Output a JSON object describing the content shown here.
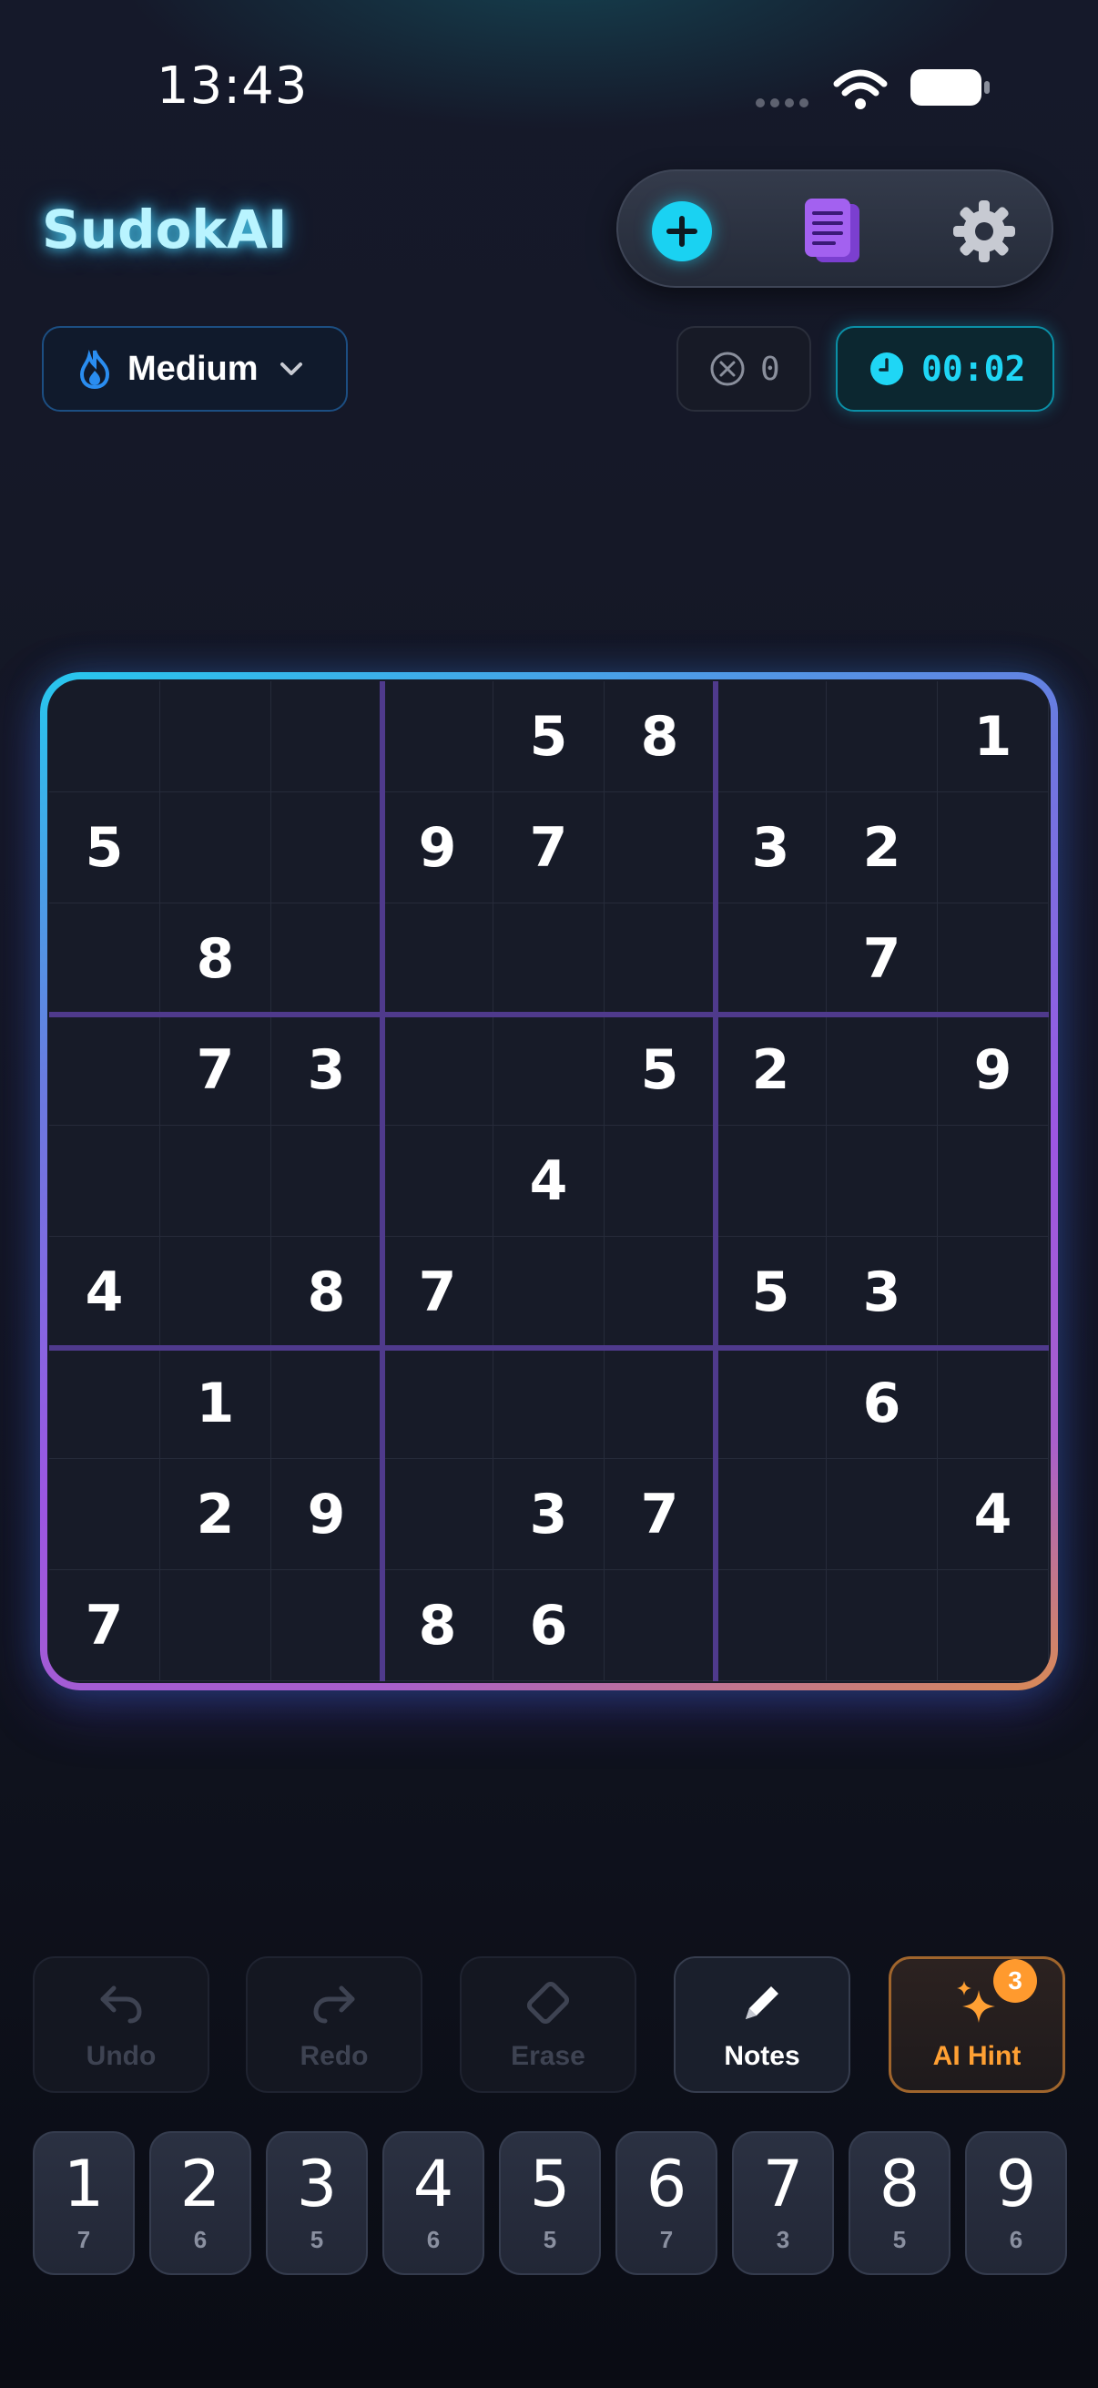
{
  "status_bar": {
    "time": "13:43"
  },
  "header": {
    "app_title": "SudokAI"
  },
  "toolbar": {
    "new_game_icon": "plus-icon",
    "notebook_icon": "notebook-icon",
    "settings_icon": "gear-icon"
  },
  "difficulty": {
    "label": "Medium",
    "icon": "flame-icon"
  },
  "stats": {
    "mistakes": "0",
    "timer": "00:02"
  },
  "board": {
    "rows": [
      [
        "",
        "",
        "",
        "",
        "5",
        "8",
        "",
        "",
        "1"
      ],
      [
        "5",
        "",
        "",
        "9",
        "7",
        "",
        "3",
        "2",
        ""
      ],
      [
        "",
        "8",
        "",
        "",
        "",
        "",
        "",
        "7",
        ""
      ],
      [
        "",
        "7",
        "3",
        "",
        "",
        "5",
        "2",
        "",
        "9"
      ],
      [
        "",
        "",
        "",
        "",
        "4",
        "",
        "",
        "",
        ""
      ],
      [
        "4",
        "",
        "8",
        "7",
        "",
        "",
        "5",
        "3",
        ""
      ],
      [
        "",
        "1",
        "",
        "",
        "",
        "",
        "",
        "6",
        ""
      ],
      [
        "",
        "2",
        "9",
        "",
        "3",
        "7",
        "",
        "",
        "4"
      ],
      [
        "7",
        "",
        "",
        "8",
        "6",
        "",
        "",
        "",
        ""
      ]
    ]
  },
  "actions": {
    "undo_label": "Undo",
    "redo_label": "Redo",
    "erase_label": "Erase",
    "notes_label": "Notes",
    "ai_hint_label": "AI Hint",
    "ai_hint_count": "3"
  },
  "number_pad": [
    {
      "digit": "1",
      "remaining": "7"
    },
    {
      "digit": "2",
      "remaining": "6"
    },
    {
      "digit": "3",
      "remaining": "5"
    },
    {
      "digit": "4",
      "remaining": "6"
    },
    {
      "digit": "5",
      "remaining": "5"
    },
    {
      "digit": "6",
      "remaining": "7"
    },
    {
      "digit": "7",
      "remaining": "3"
    },
    {
      "digit": "8",
      "remaining": "5"
    },
    {
      "digit": "9",
      "remaining": "6"
    }
  ],
  "colors": {
    "accent_cyan": "#1ad2f2",
    "accent_purple": "#9c56e2",
    "hint_orange": "#ffa033",
    "board_bg": "#171b28"
  }
}
